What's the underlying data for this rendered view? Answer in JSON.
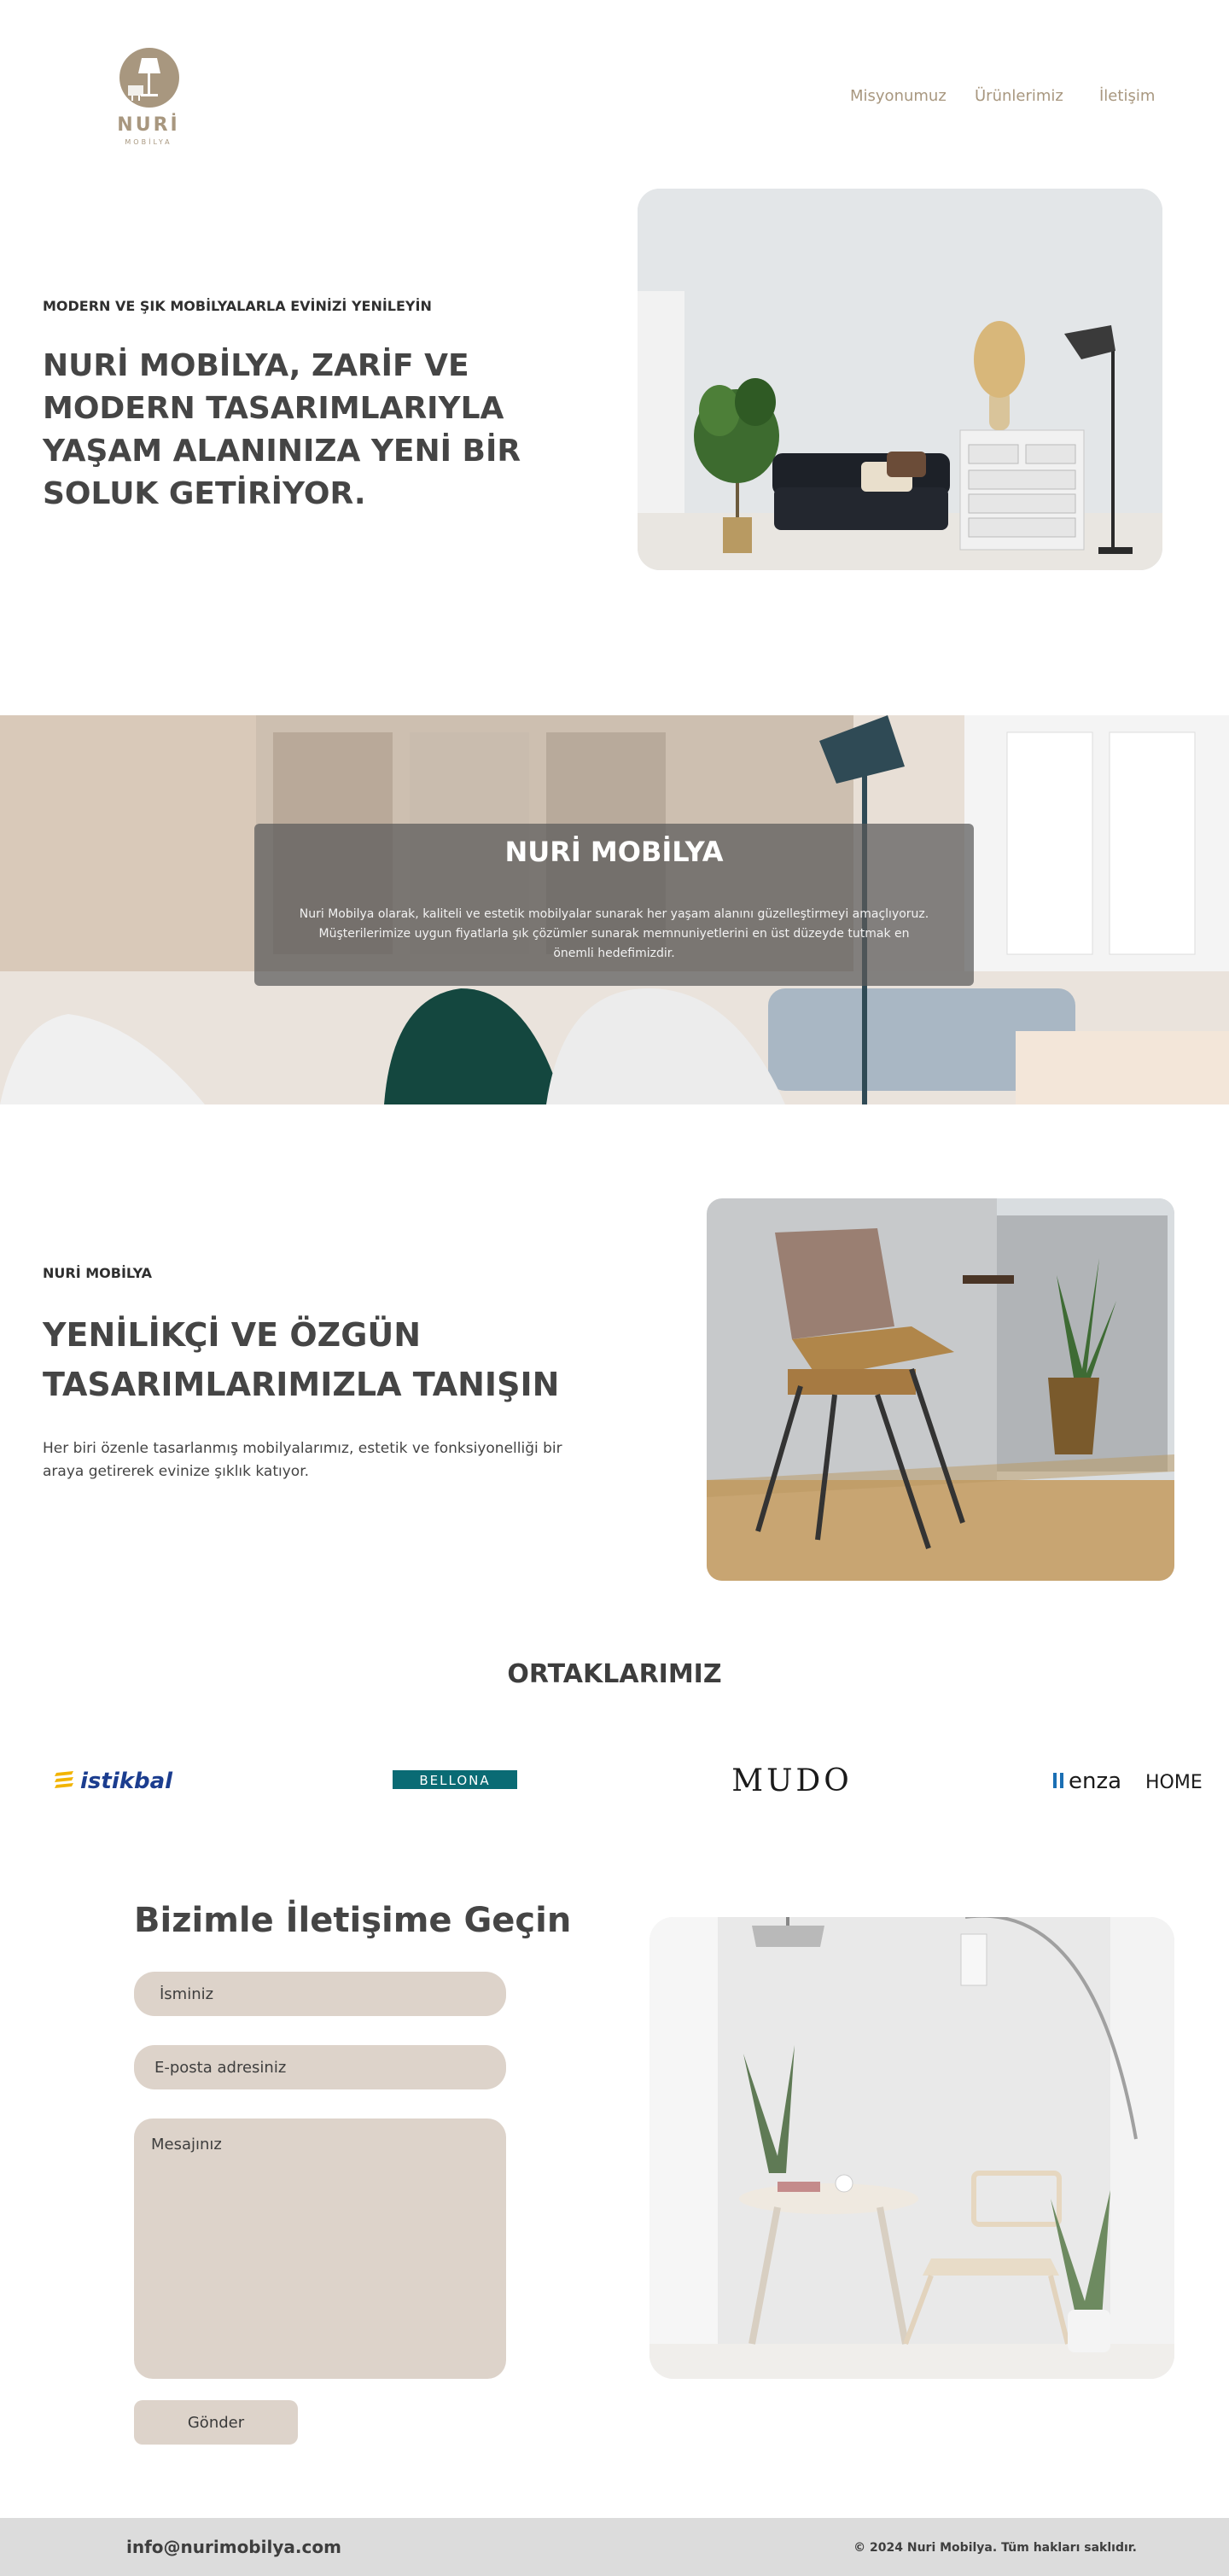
{
  "brand": {
    "name": "NURİ",
    "sub": "MOBİLYA",
    "color": "#a8977f"
  },
  "nav": [
    "Misyonumuz",
    "Ürünlerimiz",
    "İletişim"
  ],
  "hero": {
    "eyebrow": "MODERN VE ŞIK MOBİLYALARLA EVİNİZİ YENİLEYİN",
    "title": "NURİ MOBİLYA, ZARİF VE MODERN TASARIMLARIYLA YAŞAM ALANINIZA YENİ BİR SOLUK GETİRİYOR."
  },
  "banner": {
    "title": "NURİ MOBİLYA",
    "text": "Nuri Mobilya olarak, kaliteli ve estetik mobilyalar sunarak her yaşam alanını güzelleştirmeyi amaçlıyoruz. Müşterilerimize uygun fiyatlarla şık çözümler sunarak memnuniyetlerini en üst düzeyde tutmak en önemli hedefimizdir."
  },
  "section3": {
    "eyebrow": "NURİ MOBİLYA",
    "title": "YENİLİKÇİ VE ÖZGÜN TASARIMLARIMIZLA TANIŞIN",
    "text": "Her biri özenle tasarlanmış mobilyalarımız, estetik ve fonksiyonelliği bir araya getirerek evinize şıklık katıyor."
  },
  "partners": {
    "title": "ORTAKLARIMIZ",
    "logos": [
      "istikbal",
      "BELLONA",
      "MUDO",
      "enza",
      "HOME"
    ]
  },
  "contact": {
    "title": "Bizimle İletişime Geçin",
    "name_placeholder": "İsminiz",
    "email_placeholder": "E-posta adresiniz",
    "message_placeholder": "Mesajınız",
    "send_label": "Gönder"
  },
  "footer": {
    "email": "info@nurimobilya.com",
    "copyright": "© 2024 Nuri Mobilya. Tüm hakları saklıdır."
  },
  "colors": {
    "accent": "#a8977f",
    "field_bg": "#ddd3ca",
    "footer_bg": "#dcdcdc",
    "text_dark": "#454545"
  }
}
